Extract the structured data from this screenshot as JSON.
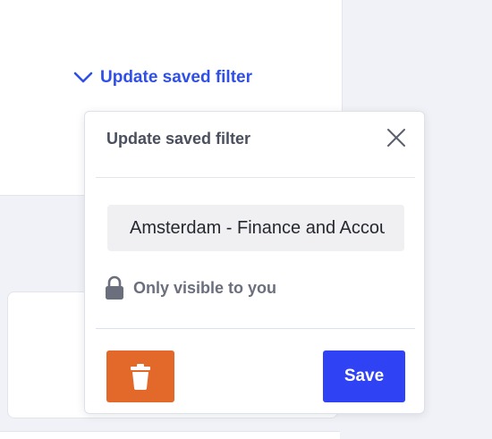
{
  "trigger": {
    "label": "Update saved filter",
    "icon": "chevron-down-icon"
  },
  "popover": {
    "title": "Update saved filter",
    "close_icon": "close-icon",
    "name_input": {
      "value": "Amsterdam - Finance and Accounting",
      "placeholder": ""
    },
    "visibility": {
      "icon": "lock-icon",
      "label": "Only visible to you"
    },
    "delete_icon": "trash-icon",
    "save_label": "Save"
  },
  "colors": {
    "accent": "#2f4fe6",
    "save_button": "#2f43f5",
    "delete_button": "#e2692a",
    "page_background": "#f1f2f7"
  }
}
